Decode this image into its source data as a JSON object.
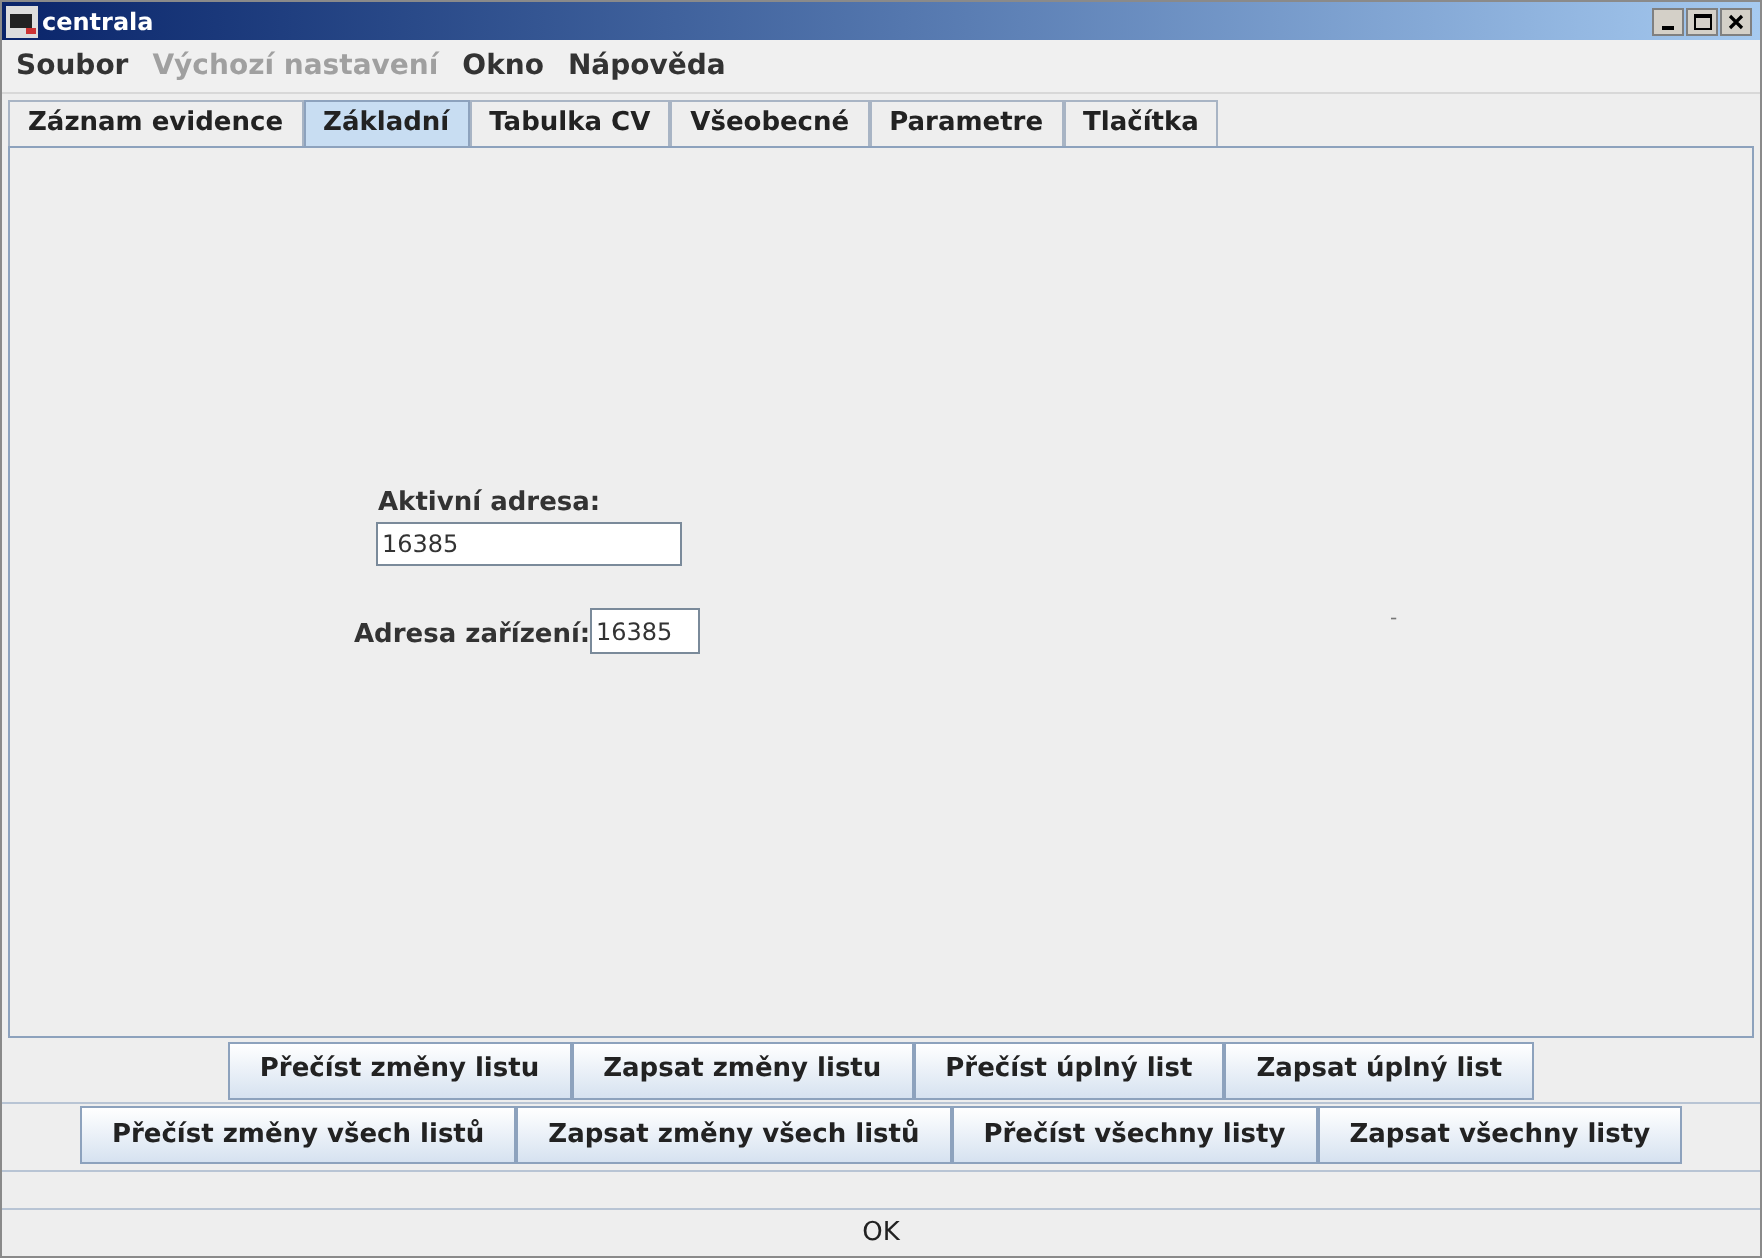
{
  "window": {
    "title": "centrala"
  },
  "menu": [
    {
      "label": "Soubor",
      "disabled": false
    },
    {
      "label": "Výchozí nastavení",
      "disabled": true
    },
    {
      "label": "Okno",
      "disabled": false
    },
    {
      "label": "Nápověda",
      "disabled": false
    }
  ],
  "tabs": [
    {
      "label": "Záznam evidence",
      "selected": false
    },
    {
      "label": "Základní",
      "selected": true
    },
    {
      "label": "Tabulka CV",
      "selected": false
    },
    {
      "label": "Všeobecné",
      "selected": false
    },
    {
      "label": "Parametre",
      "selected": false
    },
    {
      "label": "Tlačítka",
      "selected": false
    }
  ],
  "active_address": {
    "label": "Aktivní adresa:",
    "value": "16385"
  },
  "device_address": {
    "label": "Adresa zařízení:",
    "value": "16385"
  },
  "side_mark": "-",
  "sheet_buttons": [
    "Přečíst změny listu",
    "Zapsat změny listu",
    "Přečíst úplný list",
    "Zapsat úplný list"
  ],
  "all_buttons": [
    "Přečíst změny všech listů",
    "Zapsat změny všech listů",
    "Přečíst všechny listy",
    "Zapsat všechny listy"
  ],
  "ok_button": "OK"
}
